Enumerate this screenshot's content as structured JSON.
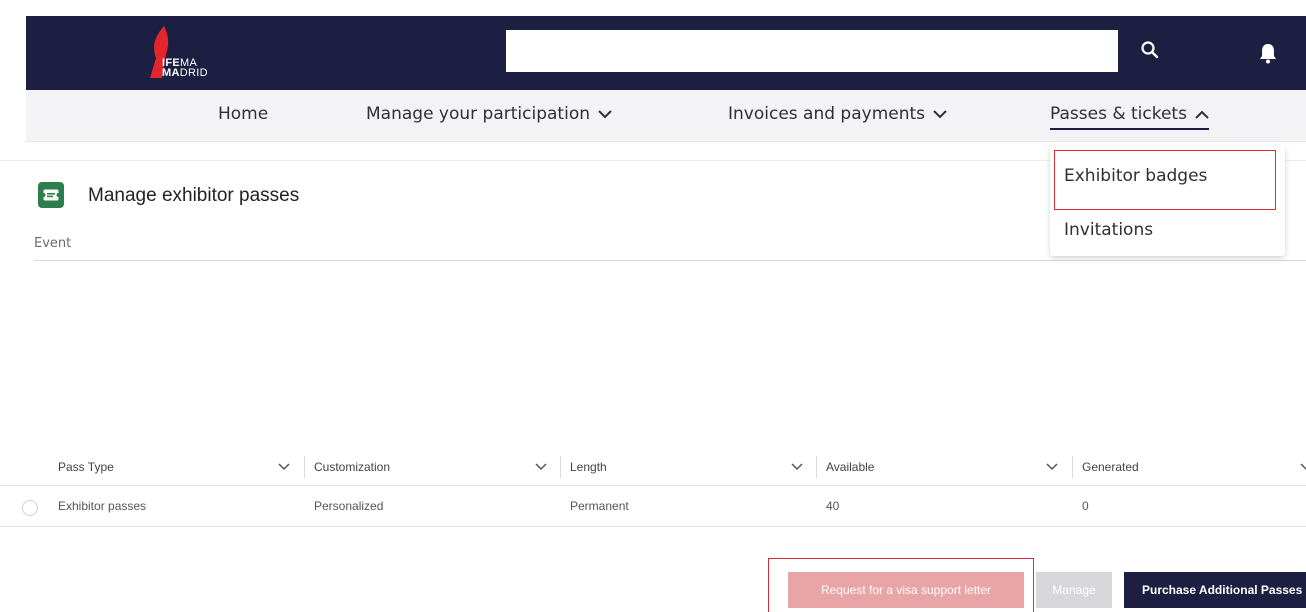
{
  "header": {
    "logo_line1_bold": "IFE",
    "logo_line1_rest": "MA",
    "logo_line2_bold": "MA",
    "logo_line2_rest": "DRID",
    "search_value": "",
    "search_icon": "search-icon",
    "notification_icon": "bell-icon"
  },
  "nav": {
    "items": [
      {
        "label": "Home"
      },
      {
        "label": "Manage your participation",
        "icon": "chevron-down-icon"
      },
      {
        "label": "Invoices and payments",
        "icon": "chevron-down-icon"
      },
      {
        "label": "Passes & tickets",
        "icon": "chevron-up-icon",
        "active": true
      }
    ]
  },
  "dropdown": {
    "items": [
      {
        "label": "Exhibitor badges"
      },
      {
        "label": "Invitations"
      }
    ]
  },
  "page": {
    "title": "Manage exhibitor passes",
    "title_icon": "ticket-icon",
    "event_label": "Event"
  },
  "table": {
    "columns": [
      "Pass Type",
      "Customization",
      "Length",
      "Available",
      "Generated"
    ],
    "rows": [
      [
        "Exhibitor passes",
        "Personalized",
        "Permanent",
        "40",
        "0"
      ]
    ]
  },
  "actions": {
    "visa_label": "Request for a visa support letter",
    "manage_label": "Manage",
    "purchase_label": "Purchase Additional Passes"
  },
  "colors": {
    "header_bg": "#1c1e42",
    "nav_bg": "#f3f3f5",
    "highlight": "#d92d35",
    "icon_green": "#2e7d4f",
    "visa_button": "#e9a4a6",
    "manage_button": "#d7d7d9",
    "logo_red": "#e4262c"
  }
}
